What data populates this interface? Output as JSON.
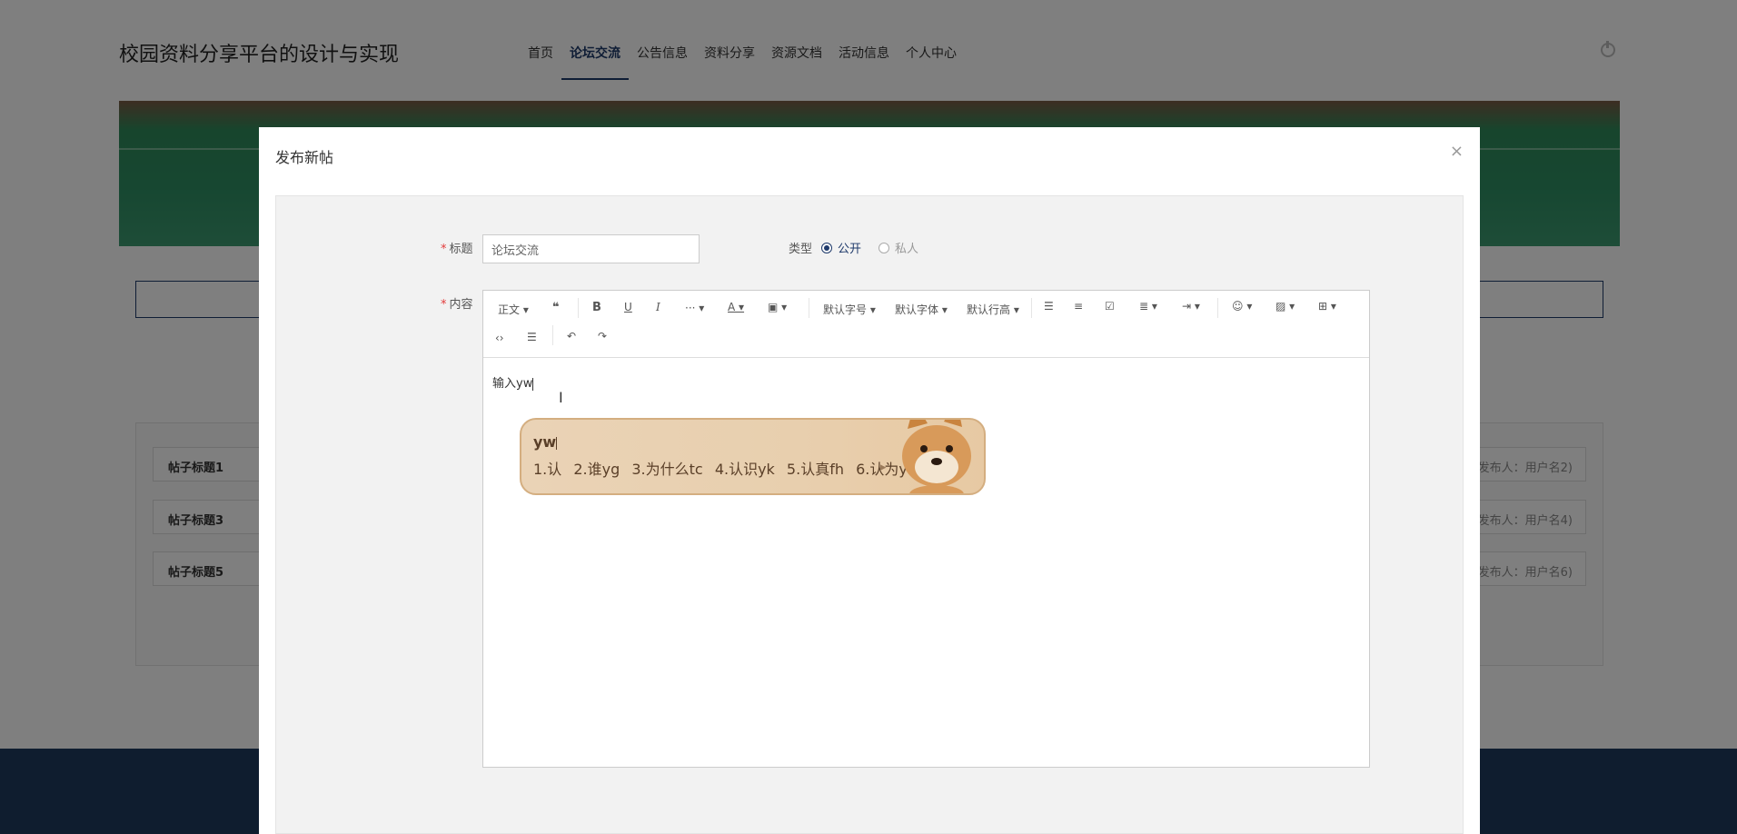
{
  "site": {
    "title": "校园资料分享平台的设计与实现",
    "nav": [
      "首页",
      "论坛交流",
      "公告信息",
      "资料分享",
      "资源文档",
      "活动信息",
      "个人中心"
    ],
    "active_nav": "论坛交流"
  },
  "posts": [
    {
      "title": "帖子标题1",
      "author": "(发布人：用户名2)"
    },
    {
      "title": "帖子标题3",
      "author": "(发布人：用户名4)"
    },
    {
      "title": "帖子标题5",
      "author": "(发布人：用户名6)"
    }
  ],
  "modal": {
    "title": "发布新帖",
    "close_symbol": "×",
    "required_mark": "*",
    "title_label": "标题",
    "title_value": "论坛交流",
    "type_label": "类型",
    "type_options": [
      {
        "label": "公开",
        "checked": true
      },
      {
        "label": "私人",
        "checked": false
      }
    ],
    "content_label": "内容",
    "content_text": "输入yw"
  },
  "toolbar": {
    "paragraph": "正文",
    "font_size": "默认字号",
    "font_family": "默认字体",
    "line_height": "默认行高",
    "icons": [
      "quote-icon",
      "bold-icon",
      "underline-icon",
      "italic-icon",
      "more-icon",
      "font-color-icon",
      "background-color-icon",
      "bullet-list-icon",
      "numbered-list-icon",
      "todo-icon",
      "align-icon",
      "indent-icon",
      "emoji-icon",
      "image-icon",
      "table-icon",
      "code-icon",
      "divider-icon",
      "undo-icon",
      "redo-icon"
    ]
  },
  "ime": {
    "input": "yw",
    "candidates": [
      "1.认",
      "2.谁yg",
      "3.为什么tc",
      "4.认识yk",
      "5.认真fh",
      "6.认为yl"
    ]
  },
  "colors": {
    "accent": "#1f3a6b",
    "footer": "#1e3a5f",
    "required": "#e23b3b"
  }
}
